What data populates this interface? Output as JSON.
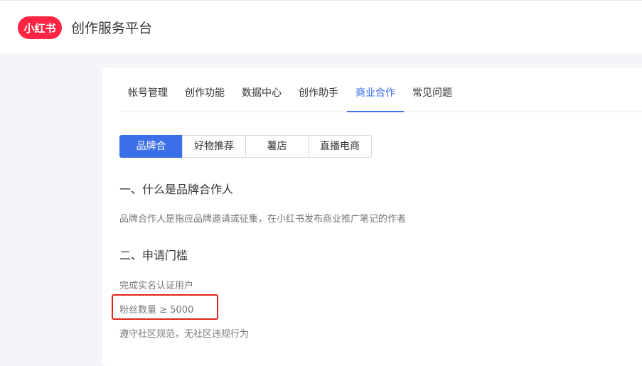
{
  "header": {
    "logo_text": "小红书",
    "title": "创作服务平台"
  },
  "tabs": [
    {
      "label": "帐号管理"
    },
    {
      "label": "创作功能"
    },
    {
      "label": "数据中心"
    },
    {
      "label": "创作助手"
    },
    {
      "label": "商业合作",
      "active": true
    },
    {
      "label": "常见问题"
    }
  ],
  "segments": [
    {
      "label": "品牌合作",
      "active": true
    },
    {
      "label": "好物推荐"
    },
    {
      "label": "薯店"
    },
    {
      "label": "直播电商"
    }
  ],
  "content": {
    "section1_title": "一、什么是品牌合作人",
    "section1_text": "品牌合作人是指应品牌邀请或征集，在小红书发布商业推广笔记的作者",
    "section2_title": "二、申请门槛",
    "requirements": [
      "完成实名认证用户",
      "粉丝数量 ≥ 5000",
      "遵守社区规范，无社区违规行为"
    ]
  },
  "colors": {
    "brand": "#ff2442",
    "accent": "#3b6fe8",
    "highlight": "#e0261b"
  }
}
